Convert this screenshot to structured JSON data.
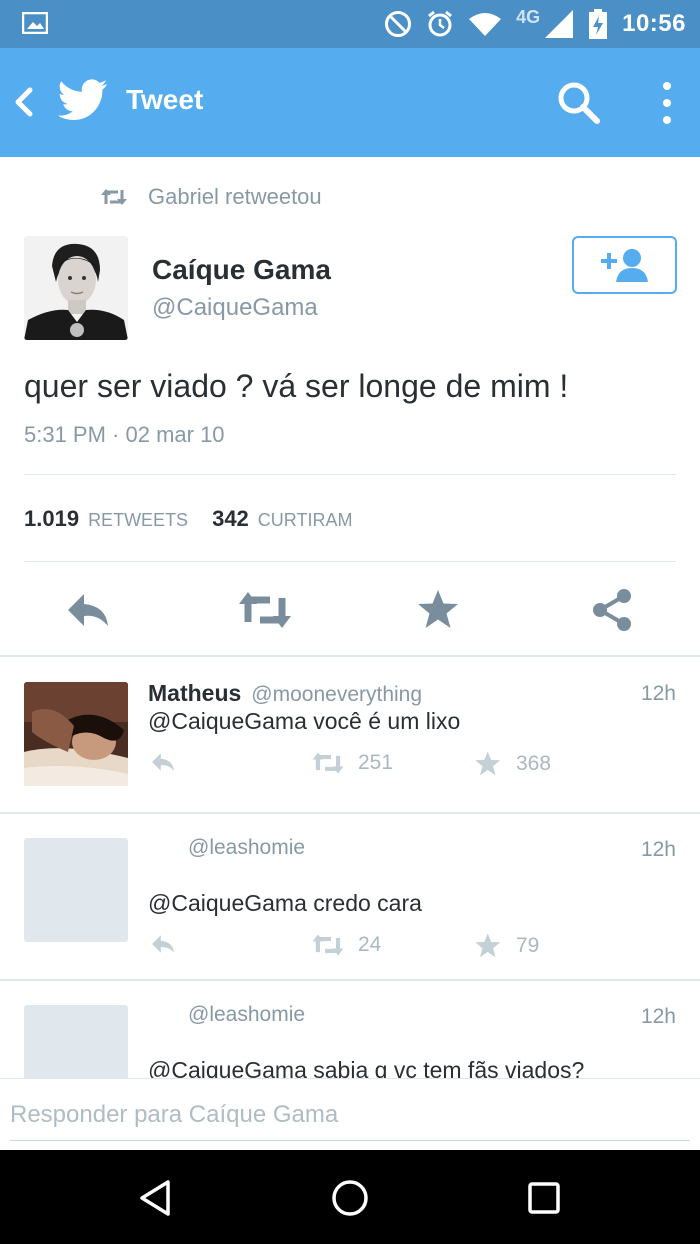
{
  "status_bar": {
    "time": "10:56",
    "network": "4G",
    "icons": [
      "image-icon",
      "do-not-disturb-icon",
      "alarm-icon",
      "wifi-icon",
      "signal-icon",
      "battery-charging-icon"
    ]
  },
  "app_bar": {
    "title": "Tweet",
    "icons": [
      "back-icon",
      "twitter-bird-icon",
      "search-icon",
      "more-vert-icon"
    ]
  },
  "tweet": {
    "retweeted_by": "Gabriel retweetou",
    "author_name": "Caíque Gama",
    "author_handle": "@CaiqueGama",
    "text": "quer ser viado ? vá ser longe de mim !",
    "timestamp": "5:31 PM · 02 mar 10",
    "retweets_count": "1.019",
    "retweets_label": "RETWEETS",
    "likes_count": "342",
    "likes_label": "CURTIRAM",
    "actions": [
      "reply-icon",
      "retweet-icon",
      "favorite-star-icon",
      "share-icon"
    ]
  },
  "replies": [
    {
      "name": "Matheus",
      "handle": "@mooneverything",
      "time": "12h",
      "text": "@CaiqueGama você é um lixo",
      "retweets": "251",
      "favorites": "368"
    },
    {
      "name": "",
      "handle": "@leashomie",
      "time": "12h",
      "text": "@CaiqueGama credo cara",
      "retweets": "24",
      "favorites": "79"
    },
    {
      "name": "",
      "handle": "@leashomie",
      "time": "12h",
      "text": "@CaiqueGama sabia q vc tem fãs viados?"
    }
  ],
  "reply_input": {
    "placeholder": "Responder para Caíque Gama",
    "value": ""
  },
  "nav_bar": {
    "icons": [
      "nav-back-icon",
      "nav-home-icon",
      "nav-recents-icon"
    ]
  },
  "colors": {
    "status_bar": "#4a8fc6",
    "app_bar": "#55acee",
    "muted_text": "#8899a6",
    "action_icons": "#7a8d9c",
    "divider": "#e1e8ed"
  }
}
